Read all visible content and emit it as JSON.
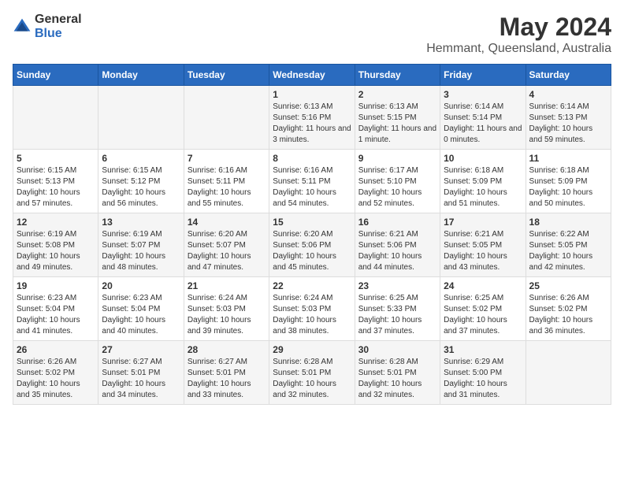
{
  "logo": {
    "general": "General",
    "blue": "Blue"
  },
  "title": "May 2024",
  "subtitle": "Hemmant, Queensland, Australia",
  "headers": [
    "Sunday",
    "Monday",
    "Tuesday",
    "Wednesday",
    "Thursday",
    "Friday",
    "Saturday"
  ],
  "weeks": [
    [
      {
        "day": "",
        "info": ""
      },
      {
        "day": "",
        "info": ""
      },
      {
        "day": "",
        "info": ""
      },
      {
        "day": "1",
        "info": "Sunrise: 6:13 AM\nSunset: 5:16 PM\nDaylight: 11 hours and 3 minutes."
      },
      {
        "day": "2",
        "info": "Sunrise: 6:13 AM\nSunset: 5:15 PM\nDaylight: 11 hours and 1 minute."
      },
      {
        "day": "3",
        "info": "Sunrise: 6:14 AM\nSunset: 5:14 PM\nDaylight: 11 hours and 0 minutes."
      },
      {
        "day": "4",
        "info": "Sunrise: 6:14 AM\nSunset: 5:13 PM\nDaylight: 10 hours and 59 minutes."
      }
    ],
    [
      {
        "day": "5",
        "info": "Sunrise: 6:15 AM\nSunset: 5:13 PM\nDaylight: 10 hours and 57 minutes."
      },
      {
        "day": "6",
        "info": "Sunrise: 6:15 AM\nSunset: 5:12 PM\nDaylight: 10 hours and 56 minutes."
      },
      {
        "day": "7",
        "info": "Sunrise: 6:16 AM\nSunset: 5:11 PM\nDaylight: 10 hours and 55 minutes."
      },
      {
        "day": "8",
        "info": "Sunrise: 6:16 AM\nSunset: 5:11 PM\nDaylight: 10 hours and 54 minutes."
      },
      {
        "day": "9",
        "info": "Sunrise: 6:17 AM\nSunset: 5:10 PM\nDaylight: 10 hours and 52 minutes."
      },
      {
        "day": "10",
        "info": "Sunrise: 6:18 AM\nSunset: 5:09 PM\nDaylight: 10 hours and 51 minutes."
      },
      {
        "day": "11",
        "info": "Sunrise: 6:18 AM\nSunset: 5:09 PM\nDaylight: 10 hours and 50 minutes."
      }
    ],
    [
      {
        "day": "12",
        "info": "Sunrise: 6:19 AM\nSunset: 5:08 PM\nDaylight: 10 hours and 49 minutes."
      },
      {
        "day": "13",
        "info": "Sunrise: 6:19 AM\nSunset: 5:07 PM\nDaylight: 10 hours and 48 minutes."
      },
      {
        "day": "14",
        "info": "Sunrise: 6:20 AM\nSunset: 5:07 PM\nDaylight: 10 hours and 47 minutes."
      },
      {
        "day": "15",
        "info": "Sunrise: 6:20 AM\nSunset: 5:06 PM\nDaylight: 10 hours and 45 minutes."
      },
      {
        "day": "16",
        "info": "Sunrise: 6:21 AM\nSunset: 5:06 PM\nDaylight: 10 hours and 44 minutes."
      },
      {
        "day": "17",
        "info": "Sunrise: 6:21 AM\nSunset: 5:05 PM\nDaylight: 10 hours and 43 minutes."
      },
      {
        "day": "18",
        "info": "Sunrise: 6:22 AM\nSunset: 5:05 PM\nDaylight: 10 hours and 42 minutes."
      }
    ],
    [
      {
        "day": "19",
        "info": "Sunrise: 6:23 AM\nSunset: 5:04 PM\nDaylight: 10 hours and 41 minutes."
      },
      {
        "day": "20",
        "info": "Sunrise: 6:23 AM\nSunset: 5:04 PM\nDaylight: 10 hours and 40 minutes."
      },
      {
        "day": "21",
        "info": "Sunrise: 6:24 AM\nSunset: 5:03 PM\nDaylight: 10 hours and 39 minutes."
      },
      {
        "day": "22",
        "info": "Sunrise: 6:24 AM\nSunset: 5:03 PM\nDaylight: 10 hours and 38 minutes."
      },
      {
        "day": "23",
        "info": "Sunrise: 6:25 AM\nSunset: 5:33 PM\nDaylight: 10 hours and 37 minutes."
      },
      {
        "day": "24",
        "info": "Sunrise: 6:25 AM\nSunset: 5:02 PM\nDaylight: 10 hours and 37 minutes."
      },
      {
        "day": "25",
        "info": "Sunrise: 6:26 AM\nSunset: 5:02 PM\nDaylight: 10 hours and 36 minutes."
      }
    ],
    [
      {
        "day": "26",
        "info": "Sunrise: 6:26 AM\nSunset: 5:02 PM\nDaylight: 10 hours and 35 minutes."
      },
      {
        "day": "27",
        "info": "Sunrise: 6:27 AM\nSunset: 5:01 PM\nDaylight: 10 hours and 34 minutes."
      },
      {
        "day": "28",
        "info": "Sunrise: 6:27 AM\nSunset: 5:01 PM\nDaylight: 10 hours and 33 minutes."
      },
      {
        "day": "29",
        "info": "Sunrise: 6:28 AM\nSunset: 5:01 PM\nDaylight: 10 hours and 32 minutes."
      },
      {
        "day": "30",
        "info": "Sunrise: 6:28 AM\nSunset: 5:01 PM\nDaylight: 10 hours and 32 minutes."
      },
      {
        "day": "31",
        "info": "Sunrise: 6:29 AM\nSunset: 5:00 PM\nDaylight: 10 hours and 31 minutes."
      },
      {
        "day": "",
        "info": ""
      }
    ]
  ]
}
